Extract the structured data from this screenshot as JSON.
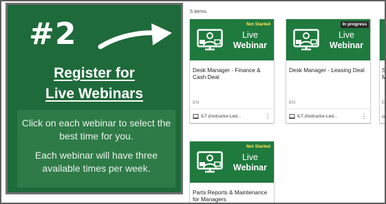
{
  "promo": {
    "number": "#2",
    "heading_line1": "Register for",
    "heading_line2": "Live Webinars",
    "body1": "Click on each webinar to select the best time for you.",
    "body2": "Each webinar will have three available times per week."
  },
  "catalog": {
    "items_count": "5 items",
    "cards": [
      {
        "status": "Not Started",
        "thumb_line1": "Live",
        "thumb_line2": "Webinar",
        "title": "Desk Manager - Finance & Cash Deal",
        "language": "EN",
        "type": "ILT (Instructor-Led...",
        "menu": "⋮"
      },
      {
        "status": "In progress",
        "thumb_line1": "Live",
        "thumb_line2": "Webinar",
        "title": "Desk Manager - Leasing Deal",
        "language": "EN",
        "type": "ILT (Instructor-Led...",
        "menu": "⋮"
      },
      {
        "title": "Sa M",
        "language": "EN"
      },
      {
        "status": "Not Started",
        "thumb_line1": "Live",
        "thumb_line2": "Webinar",
        "title": "Parts Reports & Maintenance for Managers"
      }
    ]
  },
  "colors": {
    "promo_green": "#1c6b3b",
    "thumb_green": "#1f7a3e",
    "not_started_text": "#ffe85c",
    "in_progress_bg": "#2b2b2b"
  },
  "icons": {
    "arrow": "right-arrow-icon",
    "monitor": "webinar-presenter-icon",
    "type": "laptop-icon",
    "menu": "more-vertical-icon"
  }
}
